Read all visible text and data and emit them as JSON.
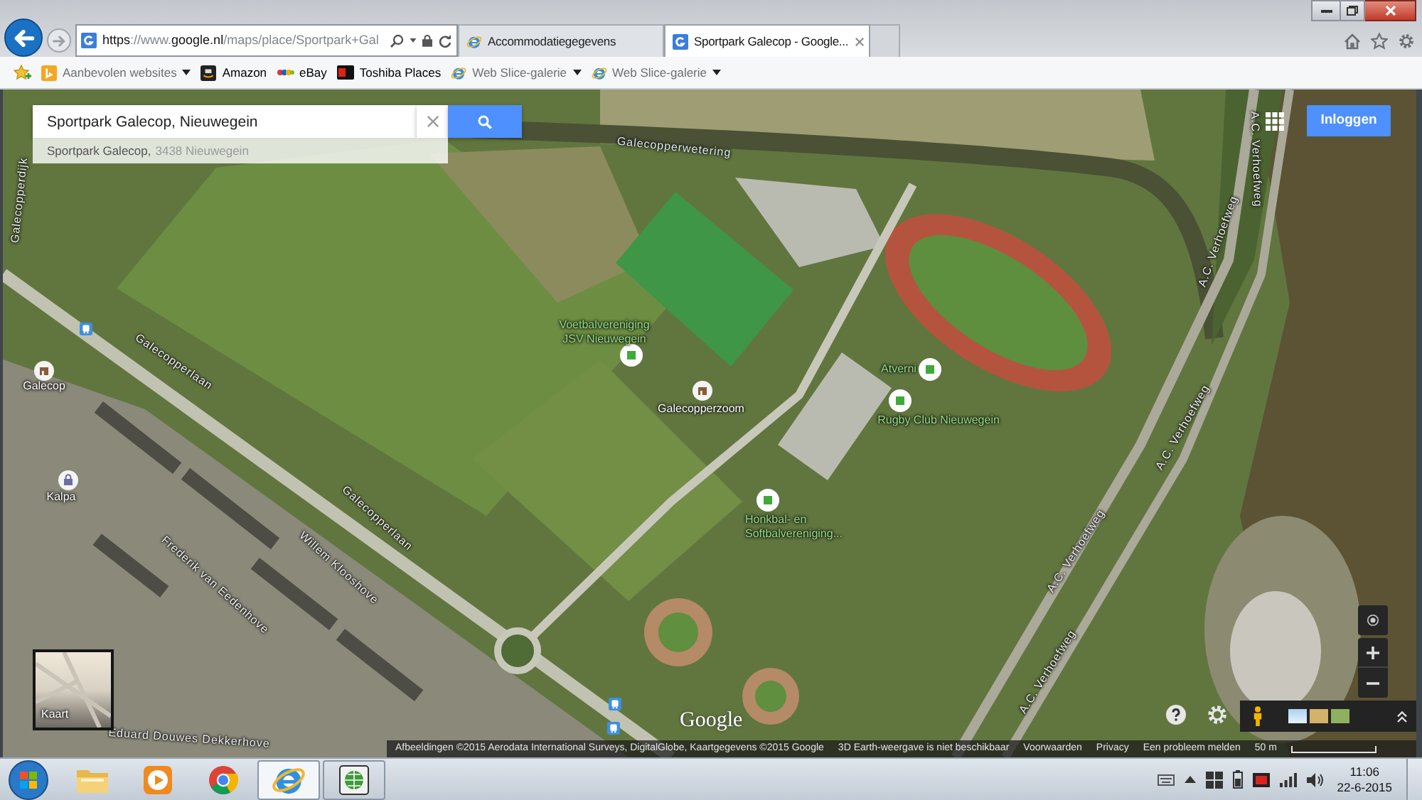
{
  "browser": {
    "nav": {
      "back_disabled": false,
      "forward_disabled": true
    },
    "url_parts": [
      {
        "text": "https",
        "highlighted": true
      },
      {
        "text": "://www.",
        "highlighted": false
      },
      {
        "text": "google.nl",
        "highlighted": true
      },
      {
        "text": "/maps/place/Sportpark+Gal",
        "highlighted": false
      }
    ],
    "tabs": [
      {
        "title": "Accommodatiegegevens",
        "selected": false
      },
      {
        "title": "Sportpark Galecop - Google...",
        "selected": true
      }
    ],
    "favorites": [
      {
        "label": "Aanbevolen websites",
        "has_menu": true,
        "dimmed": true
      },
      {
        "label": "Amazon",
        "has_menu": false,
        "dimmed": false
      },
      {
        "label": "eBay",
        "has_menu": false,
        "dimmed": false
      },
      {
        "label": "Toshiba Places",
        "has_menu": false,
        "dimmed": false
      },
      {
        "label": "Web Slice-galerie",
        "has_menu": true,
        "dimmed": true
      },
      {
        "label": "Web Slice-galerie",
        "has_menu": true,
        "dimmed": true
      }
    ]
  },
  "map": {
    "search": {
      "value": "Sportpark Galecop, Nieuwegein",
      "suggestion": {
        "name": "Sportpark Galecop,",
        "address": "3438 Nieuwegein"
      }
    },
    "sign_in": "Inloggen",
    "labels": [
      {
        "kind": "water",
        "lines": [
          "Galecopperwetering"
        ]
      },
      {
        "kind": "street",
        "lines": [
          "Galecopperdijk"
        ]
      },
      {
        "kind": "street",
        "lines": [
          "Galecopperlaan"
        ]
      },
      {
        "kind": "street",
        "lines": [
          "Galecopperlaan"
        ]
      },
      {
        "kind": "street",
        "lines": [
          "Willem Klooshove"
        ]
      },
      {
        "kind": "street",
        "lines": [
          "Frederik van Eedenhove"
        ]
      },
      {
        "kind": "street",
        "lines": [
          "Eduard Douwes Dekkerhove"
        ]
      },
      {
        "kind": "place",
        "lines": [
          "Galecop"
        ]
      },
      {
        "kind": "place",
        "lines": [
          "Kalpa"
        ]
      },
      {
        "kind": "poi",
        "lines": [
          "Voetbalvereniging",
          "JSV Nieuwegein"
        ]
      },
      {
        "kind": "place",
        "lines": [
          "Galecopperzoom"
        ]
      },
      {
        "kind": "poi",
        "lines": [
          "Atverni"
        ]
      },
      {
        "kind": "poi",
        "lines": [
          "Rugby Club Nieuwegein"
        ]
      },
      {
        "kind": "poi",
        "lines": [
          "Honkbal- en",
          "Softbalvereniging..."
        ]
      },
      {
        "kind": "street",
        "lines": [
          "A.C. Verhoefweg"
        ]
      },
      {
        "kind": "street",
        "lines": [
          "A.C. Verhoefweg"
        ]
      },
      {
        "kind": "street",
        "lines": [
          "A.C. Verhoefweg"
        ]
      },
      {
        "kind": "street",
        "lines": [
          "A.C. Verhoefweg"
        ]
      },
      {
        "kind": "street",
        "lines": [
          "A.C. Verhoefweg"
        ]
      }
    ],
    "mini_map": "Kaart",
    "logo": "Google",
    "attribution": {
      "credits": "Afbeeldingen ©2015 Aerodata International Surveys, DigitalGlobe, Kaartgegevens ©2015 Google",
      "notice": "3D Earth-weergave is niet beschikbaar",
      "links": [
        "Voorwaarden",
        "Privacy",
        "Een probleem melden"
      ],
      "scale": "50 m"
    }
  },
  "taskbar": {
    "apps": [
      {
        "selected": false,
        "running": false
      },
      {
        "selected": false,
        "running": false
      },
      {
        "selected": false,
        "running": false
      },
      {
        "selected": true,
        "running": true
      },
      {
        "selected": false,
        "running": true
      }
    ],
    "clock": {
      "time": "11:06",
      "date": "22-6-2015"
    }
  }
}
